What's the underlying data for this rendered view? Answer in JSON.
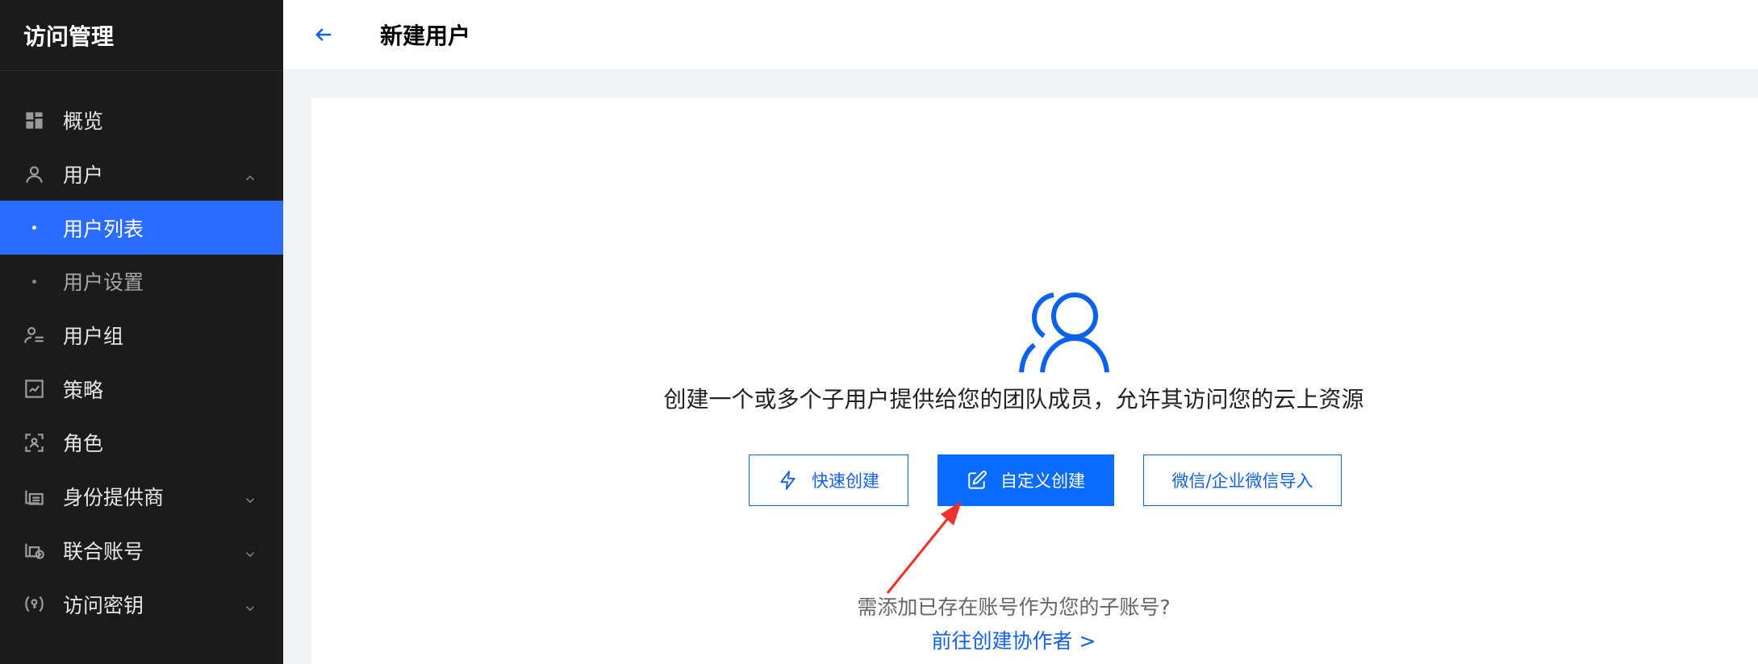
{
  "sidebar": {
    "title": "访问管理",
    "items": [
      {
        "label": "概览",
        "icon": "grid-icon"
      },
      {
        "label": "用户",
        "icon": "user-icon",
        "expanded": true
      },
      {
        "label": "用户列表",
        "sub": true,
        "active": true
      },
      {
        "label": "用户设置",
        "sub": true
      },
      {
        "label": "用户组",
        "icon": "user-group-icon"
      },
      {
        "label": "策略",
        "icon": "policy-icon"
      },
      {
        "label": "角色",
        "icon": "role-icon"
      },
      {
        "label": "身份提供商",
        "icon": "identity-provider-icon",
        "expandable": true
      },
      {
        "label": "联合账号",
        "icon": "federated-account-icon",
        "expandable": true
      },
      {
        "label": "访问密钥",
        "icon": "access-key-icon",
        "expandable": true
      }
    ]
  },
  "header": {
    "title": "新建用户"
  },
  "main": {
    "description": "创建一个或多个子用户提供给您的团队成员，允许其访问您的云上资源",
    "buttons": {
      "quick": "快速创建",
      "custom": "自定义创建",
      "wechat": "微信/企业微信导入"
    },
    "note": "需添加已存在账号作为您的子账号?",
    "link": "前往创建协作者 >"
  },
  "colors": {
    "sidebar_bg": "#1b1b1b",
    "active_item": "#2a6cff",
    "primary": "#0a6cff",
    "link": "#1261e8",
    "annotation_arrow": "#f0302a"
  }
}
